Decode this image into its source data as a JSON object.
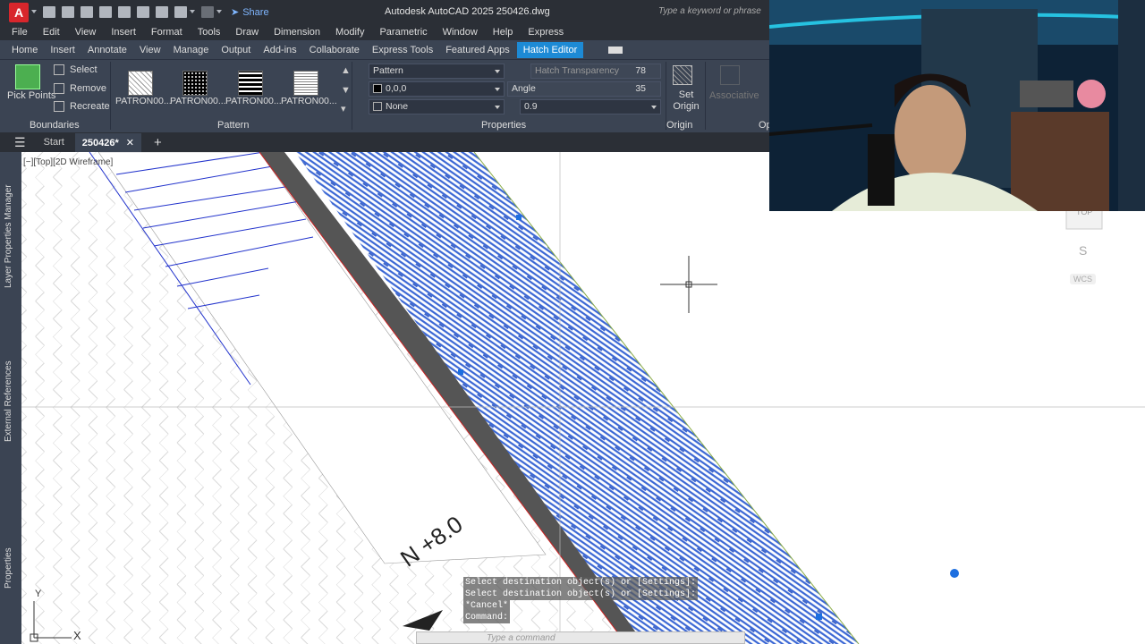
{
  "titlebar": {
    "logo": "A",
    "share": "Share",
    "title": "Autodesk AutoCAD 2025    250426.dwg",
    "search_placeholder": "Type a keyword or phrase"
  },
  "menu": [
    "File",
    "Edit",
    "View",
    "Insert",
    "Format",
    "Tools",
    "Draw",
    "Dimension",
    "Modify",
    "Parametric",
    "Window",
    "Help",
    "Express"
  ],
  "tabs": [
    "Home",
    "Insert",
    "Annotate",
    "View",
    "Manage",
    "Output",
    "Add-ins",
    "Collaborate",
    "Express Tools",
    "Featured Apps",
    "Hatch Editor"
  ],
  "ribbon": {
    "boundaries": {
      "pick_points": "Pick Points",
      "select": "Select",
      "remove": "Remove",
      "recreate": "Recreate",
      "label": "Boundaries"
    },
    "pattern": {
      "items": [
        "PATRON00...",
        "PATRON00...",
        "PATRON00...",
        "PATRON00..."
      ],
      "label": "Pattern"
    },
    "properties": {
      "type": "Pattern",
      "color": "0,0,0",
      "background": "None",
      "transparency_label": "Hatch Transparency",
      "transparency_value": "78",
      "angle_label": "Angle",
      "angle_value": "35",
      "scale_value": "0.9",
      "label": "Properties"
    },
    "origin": {
      "set_origin": "Set Origin",
      "label": "Origin"
    },
    "options": {
      "associative": "Associative",
      "label": "Op"
    }
  },
  "doctabs": {
    "start": "Start",
    "file": "250426*"
  },
  "sidebar": [
    "Layer Properties Manager",
    "External References",
    "Properties"
  ],
  "viewport": {
    "label": "[−][Top][2D Wireframe]",
    "annotation": "N +8.0",
    "ucs_x": "X",
    "ucs_y": "Y",
    "wcs": "WCS",
    "cube_top": "TOP",
    "cube_s": "S"
  },
  "command": {
    "lines": [
      "Select destination object(s) or [Settings]:",
      "Select destination object(s) or [Settings]:",
      "*Cancel*",
      "Command:"
    ],
    "placeholder": "Type a command"
  },
  "colors": {
    "hatch": "#2f5fd0",
    "ribbon_bg": "#3b4453",
    "title_bg": "#2b2f36",
    "accent": "#1d8ad5"
  }
}
